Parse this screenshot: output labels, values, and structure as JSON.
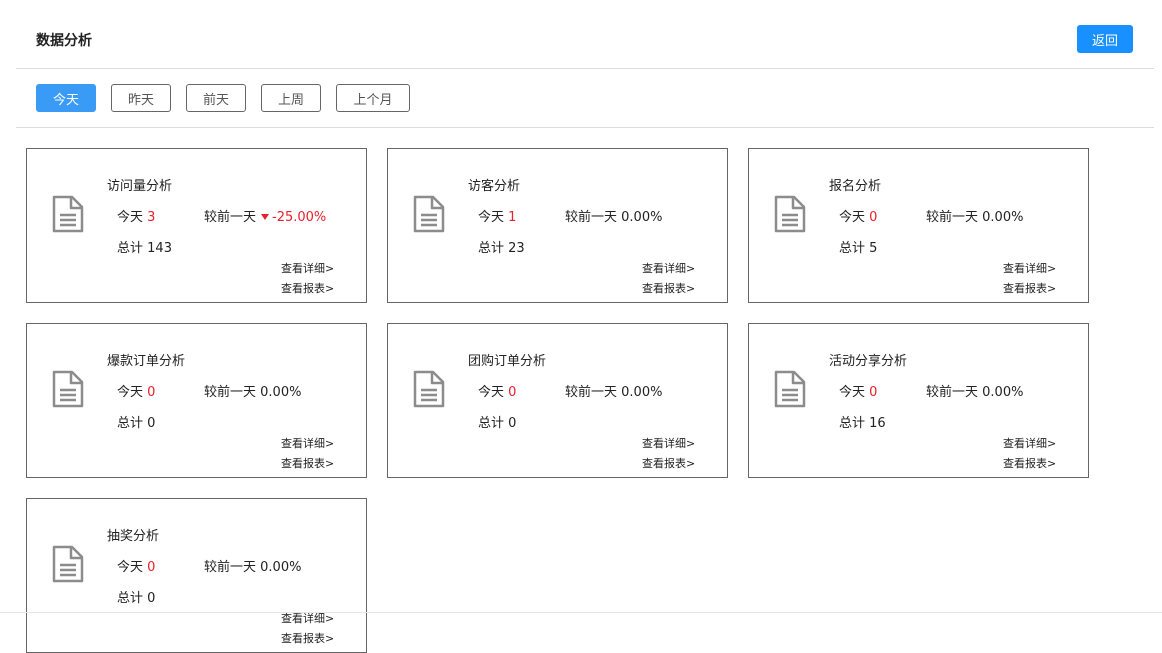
{
  "header": {
    "title": "数据分析",
    "back_label": "返回"
  },
  "filters": [
    {
      "label": "今天",
      "active": true
    },
    {
      "label": "昨天",
      "active": false
    },
    {
      "label": "前天",
      "active": false
    },
    {
      "label": "上周",
      "active": false
    },
    {
      "label": "上个月",
      "active": false
    }
  ],
  "labels": {
    "today_prefix": "今天",
    "compare_prefix": "较前一天",
    "total_prefix": "总计",
    "view_detail": "查看详细>",
    "view_report": "查看报表>"
  },
  "cards": [
    {
      "title": "访问量分析",
      "today": "3",
      "change": "-25.00%",
      "trend": "down",
      "total": "143"
    },
    {
      "title": "访客分析",
      "today": "1",
      "change": "0.00%",
      "trend": "flat",
      "total": "23"
    },
    {
      "title": "报名分析",
      "today": "0",
      "change": "0.00%",
      "trend": "flat",
      "total": "5"
    },
    {
      "title": "爆款订单分析",
      "today": "0",
      "change": "0.00%",
      "trend": "flat",
      "total": "0"
    },
    {
      "title": "团购订单分析",
      "today": "0",
      "change": "0.00%",
      "trend": "flat",
      "total": "0"
    },
    {
      "title": "活动分享分析",
      "today": "0",
      "change": "0.00%",
      "trend": "flat",
      "total": "16"
    },
    {
      "title": "抽奖分析",
      "today": "0",
      "change": "0.00%",
      "trend": "flat",
      "total": "0"
    }
  ],
  "colors": {
    "accent": "#1890ff",
    "active_filter": "#3a9bf7",
    "negative": "#e8202a",
    "icon": "#8c8c8c"
  }
}
